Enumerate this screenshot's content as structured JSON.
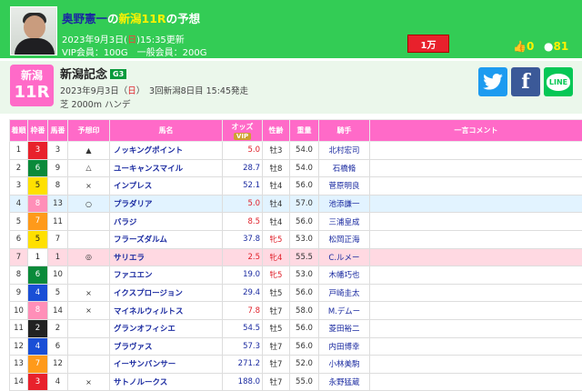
{
  "header": {
    "predictor": "奥野憲一",
    "no": "の",
    "race": "新潟11R",
    "suffix": "の予想",
    "date": "2023年9月3日(",
    "dow": "日",
    "time": ")15:35更新",
    "members": "VIP会員：100G　一般会員：200G",
    "stake_button": "1万",
    "likes": "0",
    "points": "81",
    "colors": {
      "bg": "#33cc55",
      "accent": "#fff200",
      "button": "#e8212c"
    }
  },
  "race": {
    "venue": "新潟",
    "number": "11R",
    "name": "新潟記念",
    "grade": "G3",
    "date": "2023年9月3日（",
    "dow": "日",
    "info": "）　3回新潟8日目 15:45発走",
    "course": "芝 2000m ハンデ"
  },
  "share": {
    "twitter": "twitter-icon",
    "facebook": "f",
    "line": "LINE"
  },
  "table": {
    "headers": {
      "no": "着順",
      "frame": "枠番",
      "horse_no": "馬番",
      "mark": "予想印",
      "horse": "馬名",
      "odds": "オッズ",
      "vip": "VIP",
      "sex_age": "性齢",
      "weight": "重量",
      "jockey": "騎手",
      "comment": "一言コメント"
    },
    "frame_colors": {
      "1": "#ffffff",
      "2": "#222222",
      "3": "#e8212c",
      "4": "#1a4fd6",
      "5": "#ffe000",
      "6": "#0a8a3a",
      "7": "#ff9a1a",
      "8": "#ff8fb8"
    },
    "rows": [
      {
        "pos": "1",
        "frame": "3",
        "num": "3",
        "mark": "▲",
        "horse": "ノッキングポイント",
        "odds": "5.0",
        "hot": true,
        "sex": "牡3",
        "wt": "54.0",
        "jockey": "北村宏司",
        "hl": ""
      },
      {
        "pos": "2",
        "frame": "6",
        "num": "9",
        "mark": "△",
        "horse": "ユーキャンスマイル",
        "odds": "28.7",
        "hot": false,
        "sex": "牡8",
        "wt": "54.0",
        "jockey": "石橋脩",
        "hl": ""
      },
      {
        "pos": "3",
        "frame": "5",
        "num": "8",
        "mark": "×",
        "horse": "インプレス",
        "odds": "52.1",
        "hot": false,
        "sex": "牡4",
        "wt": "56.0",
        "jockey": "菅原明良",
        "hl": ""
      },
      {
        "pos": "4",
        "frame": "8",
        "num": "13",
        "mark": "○",
        "horse": "プラダリア",
        "odds": "5.0",
        "hot": true,
        "sex": "牡4",
        "wt": "57.0",
        "jockey": "池添謙一",
        "hl": "b"
      },
      {
        "pos": "5",
        "frame": "7",
        "num": "11",
        "mark": "",
        "horse": "バラジ",
        "odds": "8.5",
        "hot": true,
        "sex": "牡4",
        "wt": "56.0",
        "jockey": "三浦皇成",
        "hl": ""
      },
      {
        "pos": "6",
        "frame": "5",
        "num": "7",
        "mark": "",
        "horse": "フラーズダルム",
        "odds": "37.8",
        "hot": false,
        "sex": "牝5",
        "wt": "53.0",
        "jockey": "松岡正海",
        "hl": ""
      },
      {
        "pos": "7",
        "frame": "1",
        "num": "1",
        "mark": "◎",
        "horse": "サリエラ",
        "odds": "2.5",
        "hot": true,
        "sex": "牝4",
        "wt": "55.5",
        "jockey": "C.ルメー",
        "hl": "r"
      },
      {
        "pos": "8",
        "frame": "6",
        "num": "10",
        "mark": "",
        "horse": "ファユエン",
        "odds": "19.0",
        "hot": false,
        "sex": "牝5",
        "wt": "53.0",
        "jockey": "木幡巧也",
        "hl": ""
      },
      {
        "pos": "9",
        "frame": "4",
        "num": "5",
        "mark": "×",
        "horse": "イクスプロージョン",
        "odds": "29.4",
        "hot": false,
        "sex": "牡5",
        "wt": "56.0",
        "jockey": "戸崎圭太",
        "hl": ""
      },
      {
        "pos": "10",
        "frame": "8",
        "num": "14",
        "mark": "×",
        "horse": "マイネルウィルトス",
        "odds": "7.8",
        "hot": true,
        "sex": "牡7",
        "wt": "58.0",
        "jockey": "M.デムー",
        "hl": ""
      },
      {
        "pos": "11",
        "frame": "2",
        "num": "2",
        "mark": "",
        "horse": "グランオフィシエ",
        "odds": "54.5",
        "hot": false,
        "sex": "牡5",
        "wt": "56.0",
        "jockey": "菱田裕二",
        "hl": ""
      },
      {
        "pos": "12",
        "frame": "4",
        "num": "6",
        "mark": "",
        "horse": "ブラヴァス",
        "odds": "57.3",
        "hot": false,
        "sex": "牡7",
        "wt": "56.0",
        "jockey": "内田博幸",
        "hl": ""
      },
      {
        "pos": "13",
        "frame": "7",
        "num": "12",
        "mark": "",
        "horse": "イーサンバンサー",
        "odds": "271.2",
        "hot": false,
        "sex": "牡7",
        "wt": "52.0",
        "jockey": "小林美駒",
        "hl": ""
      },
      {
        "pos": "14",
        "frame": "3",
        "num": "4",
        "mark": "×",
        "horse": "サトノルークス",
        "odds": "188.0",
        "hot": false,
        "sex": "牡7",
        "wt": "55.0",
        "jockey": "永野猛蔵",
        "hl": ""
      }
    ]
  }
}
